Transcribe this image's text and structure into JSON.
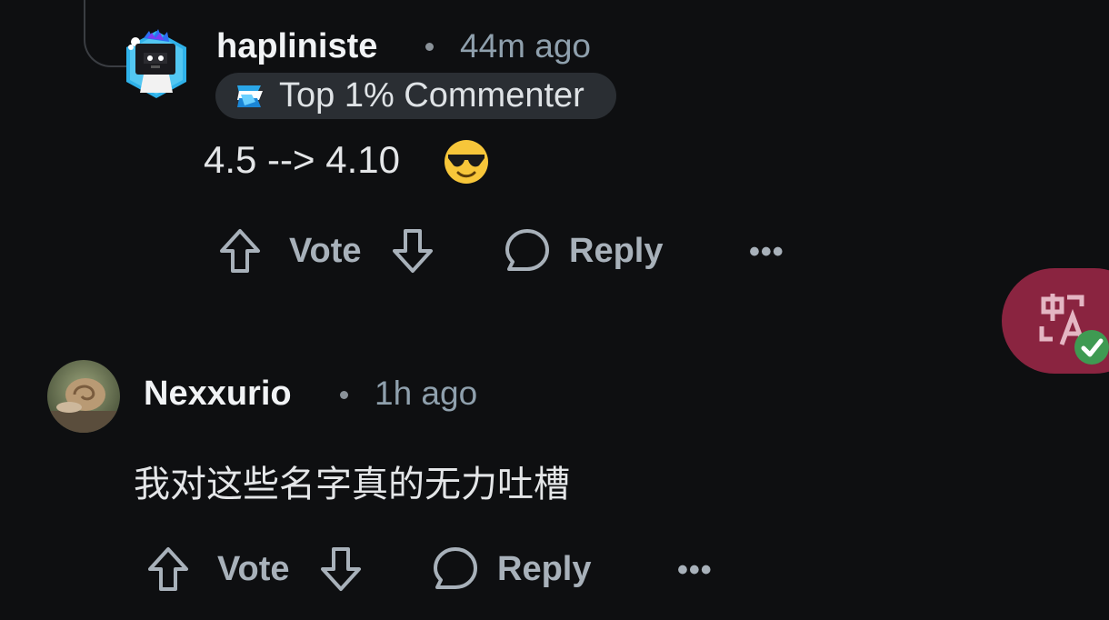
{
  "comments": [
    {
      "username": "hapliniste",
      "time": "44m ago",
      "flair": "Top 1% Commenter",
      "body": "4.5 --> 4.10",
      "emoji": "smiling-face-with-sunglasses",
      "actions": {
        "vote": "Vote",
        "reply": "Reply",
        "more": "•••"
      }
    },
    {
      "username": "Nexxurio",
      "time": "1h ago",
      "body": "我对这些名字真的无力吐槽",
      "actions": {
        "vote": "Vote",
        "reply": "Reply",
        "more": "•••"
      }
    }
  ],
  "translate_button": {
    "icon": "translate-icon",
    "status_icon": "check-icon",
    "accent": "#8a2440"
  }
}
